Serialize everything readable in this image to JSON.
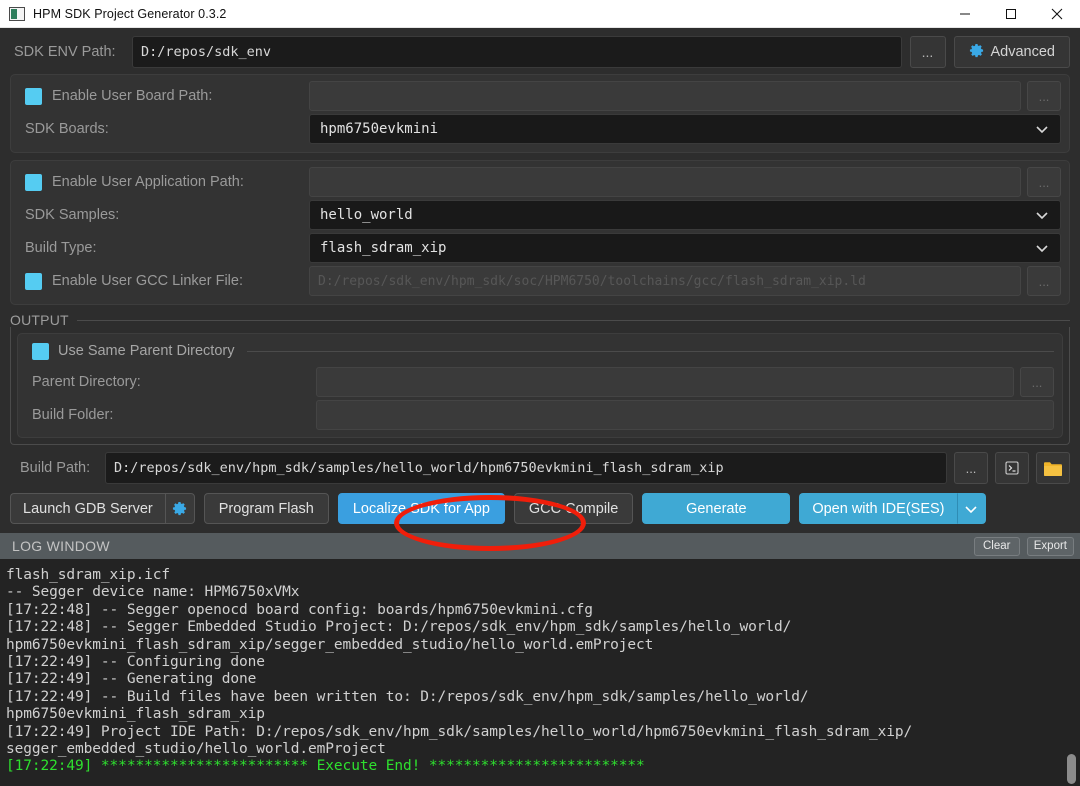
{
  "titlebar": {
    "title": "HPM SDK Project Generator 0.3.2",
    "minimize": "minimize-icon",
    "maximize": "maximize-icon",
    "close": "close-icon"
  },
  "env": {
    "label": "SDK ENV Path:",
    "value": "D:/repos/sdk_env",
    "browse_label": "...",
    "advanced_label": "Advanced"
  },
  "board_group": {
    "enable_user_board_path": {
      "label": "Enable User Board Path:",
      "value": "",
      "browse_label": "..."
    },
    "sdk_boards": {
      "label": "SDK Boards:",
      "value": "hpm6750evkmini"
    }
  },
  "app_group": {
    "enable_user_application_path": {
      "label": "Enable User Application Path:",
      "value": "",
      "browse_label": "..."
    },
    "sdk_samples": {
      "label": "SDK Samples:",
      "value": "hello_world"
    },
    "build_type": {
      "label": "Build Type:",
      "value": "flash_sdram_xip"
    },
    "enable_user_gcc_linker_file": {
      "label": "Enable User GCC Linker File:",
      "value": "D:/repos/sdk_env/hpm_sdk/soc/HPM6750/toolchains/gcc/flash_sdram_xip.ld",
      "browse_label": "..."
    }
  },
  "output": {
    "group_title": "OUTPUT",
    "use_same_parent_directory": "Use Same Parent Directory",
    "parent_directory": {
      "label": "Parent Directory:",
      "value": ""
    },
    "build_folder": {
      "label": "Build Folder:",
      "value": ""
    },
    "build_path": {
      "label": "Build Path:",
      "value": "D:/repos/sdk_env/hpm_sdk/samples/hello_world/hpm6750evkmini_flash_sdram_xip",
      "browse_label": "...",
      "terminal_label": "❯_",
      "folder_label": "folder-icon"
    }
  },
  "actions": {
    "launch_gdb_server": "Launch GDB Server",
    "gdb_settings": "gear-icon",
    "program_flash": "Program Flash",
    "localize_sdk_for_app": "Localize SDK for App",
    "gcc_compile": "GCC Compile",
    "generate": "Generate",
    "open_with_ide": "Open with IDE(SES)",
    "open_with_ide_arrow": "chevron-down-icon",
    "highlight_color": "#f01e0a"
  },
  "log": {
    "title": "LOG WINDOW",
    "clear_label": "Clear",
    "export_label": "Export",
    "lines": [
      {
        "text": "___________       ___________",
        "style": "clipped"
      },
      {
        "text": "flash_sdram_xip.icf",
        "style": "normal"
      },
      {
        "text": "-- Segger device name: HPM6750xVMx",
        "style": "normal"
      },
      {
        "text": "[17:22:48] -- Segger openocd board config: boards/hpm6750evkmini.cfg",
        "style": "normal"
      },
      {
        "text": "[17:22:48] -- Segger Embedded Studio Project: D:/repos/sdk_env/hpm_sdk/samples/hello_world/",
        "style": "normal"
      },
      {
        "text": "hpm6750evkmini_flash_sdram_xip/segger_embedded_studio/hello_world.emProject",
        "style": "normal"
      },
      {
        "text": "[17:22:49] -- Configuring done",
        "style": "normal"
      },
      {
        "text": "[17:22:49] -- Generating done",
        "style": "normal"
      },
      {
        "text": "[17:22:49] -- Build files have been written to: D:/repos/sdk_env/hpm_sdk/samples/hello_world/",
        "style": "normal"
      },
      {
        "text": "hpm6750evkmini_flash_sdram_xip",
        "style": "normal"
      },
      {
        "text": "[17:22:49] Project IDE Path: D:/repos/sdk_env/hpm_sdk/samples/hello_world/hpm6750evkmini_flash_sdram_xip/",
        "style": "normal"
      },
      {
        "text": "segger_embedded_studio/hello_world.emProject",
        "style": "normal"
      },
      {
        "text": "[17:22:49] ************************ Execute End! *************************",
        "style": "green"
      }
    ]
  },
  "colors": {
    "accent_blue": "#3fa9d4",
    "checkbox_cyan": "#55ccf2",
    "log_green": "#2ee02e",
    "annotation_red": "#f01e0a"
  }
}
